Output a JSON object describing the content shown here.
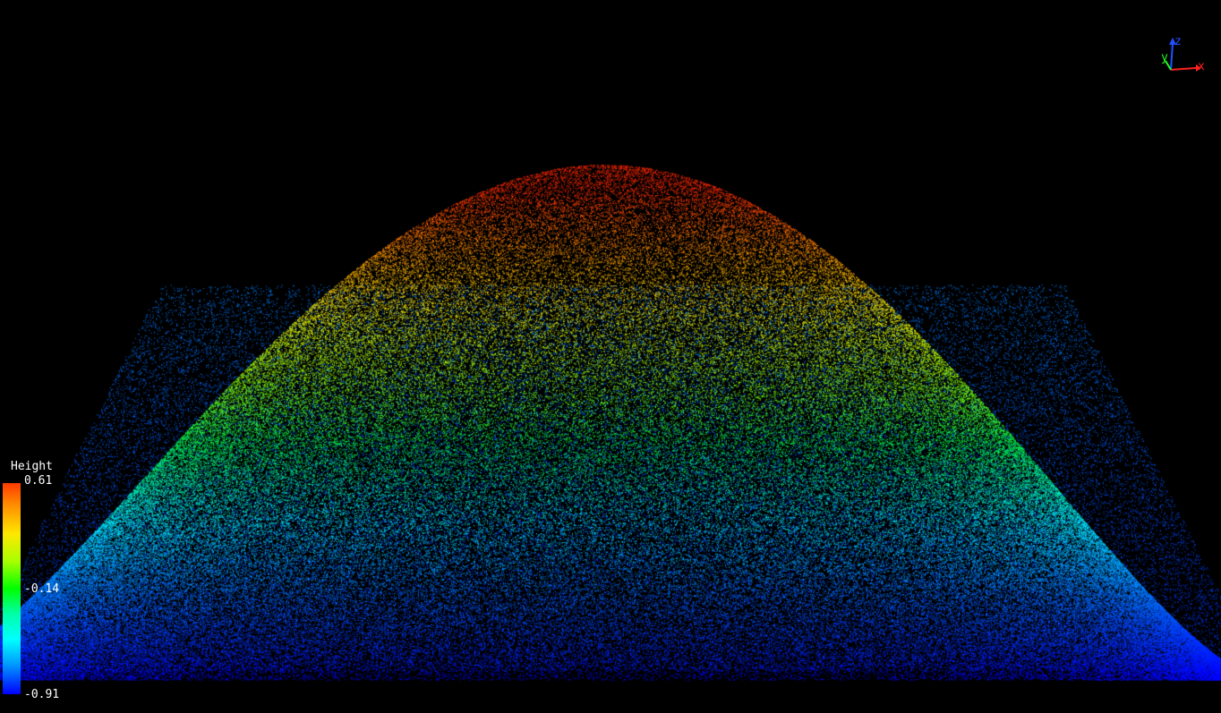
{
  "viewer": {
    "background": "#000000"
  },
  "point_cloud": {
    "subject": "mound",
    "color_scale": "height",
    "palette": [
      "#0000ff",
      "#00ffff",
      "#00ff00",
      "#ffff00",
      "#ff8000",
      "#ff2000"
    ]
  },
  "scalar_bar": {
    "title": "Height",
    "max": "0.61",
    "mid": "-0.14",
    "min": "-0.91",
    "top_color": "#ff3a00",
    "bottom_color": "#0000ff"
  },
  "axes": {
    "x_label": "x",
    "y_label": "y",
    "z_label": "z",
    "x_color": "#ff2020",
    "y_color": "#20ff20",
    "z_color": "#2050ff"
  }
}
